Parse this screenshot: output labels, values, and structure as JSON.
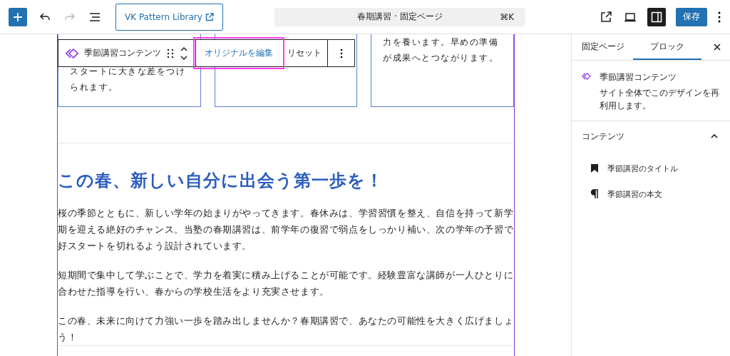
{
  "toolbar": {
    "pattern_button": "VK Pattern Library",
    "command_title": "春期講習 · 固定ページ",
    "shortcut": "⌘K",
    "redo_disabled": true,
    "settings_selected": true,
    "save": "保存"
  },
  "block_toolbar": {
    "label": "季節講習コンテンツ",
    "actions": [
      {
        "label": "オリジナルを編集",
        "highlighted": true
      },
      {
        "label": "リセット",
        "highlighted": false
      }
    ]
  },
  "cards": [
    {
      "kind": "bottom",
      "lines": [
        "スタートに大きな差をつけ",
        "られます。"
      ]
    },
    {
      "kind": "empty"
    },
    {
      "kind": "top",
      "lines": [
        "力を養います。早めの準備",
        "が成果へとつながります。"
      ]
    }
  ],
  "heading": "この春、新しい自分に出会う第一歩を！",
  "paragraphs": [
    "桜の季節とともに、新しい学年の始まりがやってきます。春休みは、学習習慣を整え、自信を持って新学期を迎える絶好のチャンス。当塾の春期講習は、前学年の復習で弱点をしっかり補い、次の学年の予習で好スタートを切れるよう設計されています。",
    "短期間で集中して学ぶことで、学力を着実に積み上げることが可能です。経験豊富な講師が一人ひとりに合わせた指導を行い、春からの学校生活をより充実させます。",
    "この春、未来に向けて力強い一歩を踏み出しませんか？春期講習で、あなたの可能性を大きく広げましょう！"
  ],
  "sidebar": {
    "tabs": [
      {
        "label": "固定ページ",
        "selected": false
      },
      {
        "label": "ブロック",
        "selected": true
      }
    ],
    "block": {
      "title": "季節講習コンテンツ",
      "description": "サイト全体でこのデザインを再利用します。"
    },
    "section": {
      "title": "コンテンツ",
      "expanded": true,
      "items": [
        {
          "kind": "heading",
          "label": "季節講習のタイトル"
        },
        {
          "kind": "paragraph",
          "label": "季節講習の本文"
        }
      ]
    }
  }
}
